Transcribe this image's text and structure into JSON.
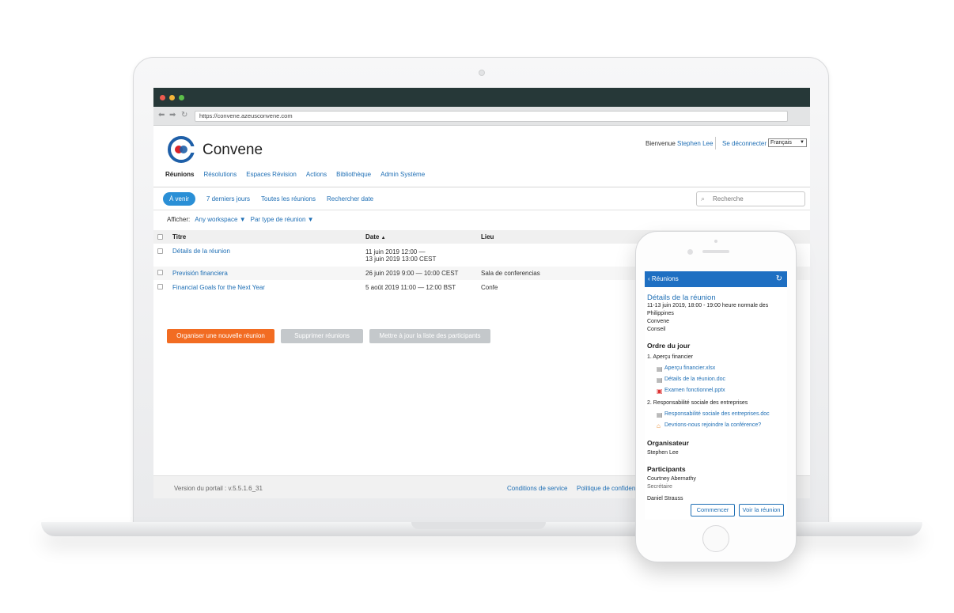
{
  "browser": {
    "url": "https://convene.azeusconvene.com"
  },
  "header": {
    "brand": "Convene",
    "welcome": "Bienvenue",
    "user": "Stephen Lee",
    "logout": "Se déconnecter",
    "language": "Français"
  },
  "nav": {
    "items": [
      "Réunions",
      "Résolutions",
      "Espaces Révision",
      "Actions",
      "Bibliothèque",
      "Admin Système"
    ]
  },
  "subnav": {
    "items": [
      "À venir",
      "7 derniers jours",
      "Toutes les réunions",
      "Rechercher date"
    ],
    "search_placeholder": "Recherche"
  },
  "filters": {
    "label": "Afficher:",
    "workspace": "Any workspace",
    "type": "Par type de réunion"
  },
  "table": {
    "headers": {
      "title": "Titre",
      "date": "Date",
      "place": "Lieu"
    },
    "rows": [
      {
        "title": "Détails de la réunion",
        "date1": "11 juin 2019 12:00 —",
        "date2": "13 juin 2019 13:00 CEST",
        "place": ""
      },
      {
        "title": "Previsión financiera",
        "date1": "26 juin 2019 9:00 — 10:00 CEST",
        "date2": "",
        "place": "Sala de conferencias"
      },
      {
        "title": "Financial Goals for the Next Year",
        "date1": "5 août 2019 11:00 — 12:00 BST",
        "date2": "",
        "place": "Confe"
      }
    ]
  },
  "actions": {
    "new_meeting": "Organiser une nouvelle réunion",
    "delete": "Supprimer réunions",
    "update_participants": "Mettre à jour la liste des participants"
  },
  "footer": {
    "version": "Version du portail : v.5.5.1.6_31",
    "terms": "Conditions de service",
    "privacy": "Politique de confident"
  },
  "mobile": {
    "back": "Réunions",
    "title": "Détails de la réunion",
    "datetime": "11-13 juin 2019, 18:00 - 19:00 heure normale des Philippines",
    "workspace": "Convene",
    "group": "Conseil",
    "agenda_heading": "Ordre du jour",
    "agenda": [
      {
        "label": "1. Aperçu financier",
        "docs": [
          "Aperçu financier.xlsx",
          "Détails de la réunion.doc",
          "Examen fonctionnel.pptx"
        ]
      },
      {
        "label": "2. Responsabilité sociale des entreprises",
        "docs": [
          "Responsabilité sociale des entreprises.doc",
          "Devrions-nous rejoindre la conférence?"
        ]
      }
    ],
    "organizer_heading": "Organisateur",
    "organizer": "Stephen Lee",
    "participants_heading": "Participants",
    "participants": [
      {
        "name": "Courtney Abernathy",
        "role": "Secrétaire"
      },
      {
        "name": "Daniel Strauss",
        "role": ""
      }
    ],
    "start_button": "Commencer",
    "view_button": "Voir la réunion"
  },
  "colors": {
    "accent": "#1f6fb5",
    "primary_button": "#f26c22",
    "pill": "#2a8fd6",
    "titlebar": "#263838"
  }
}
